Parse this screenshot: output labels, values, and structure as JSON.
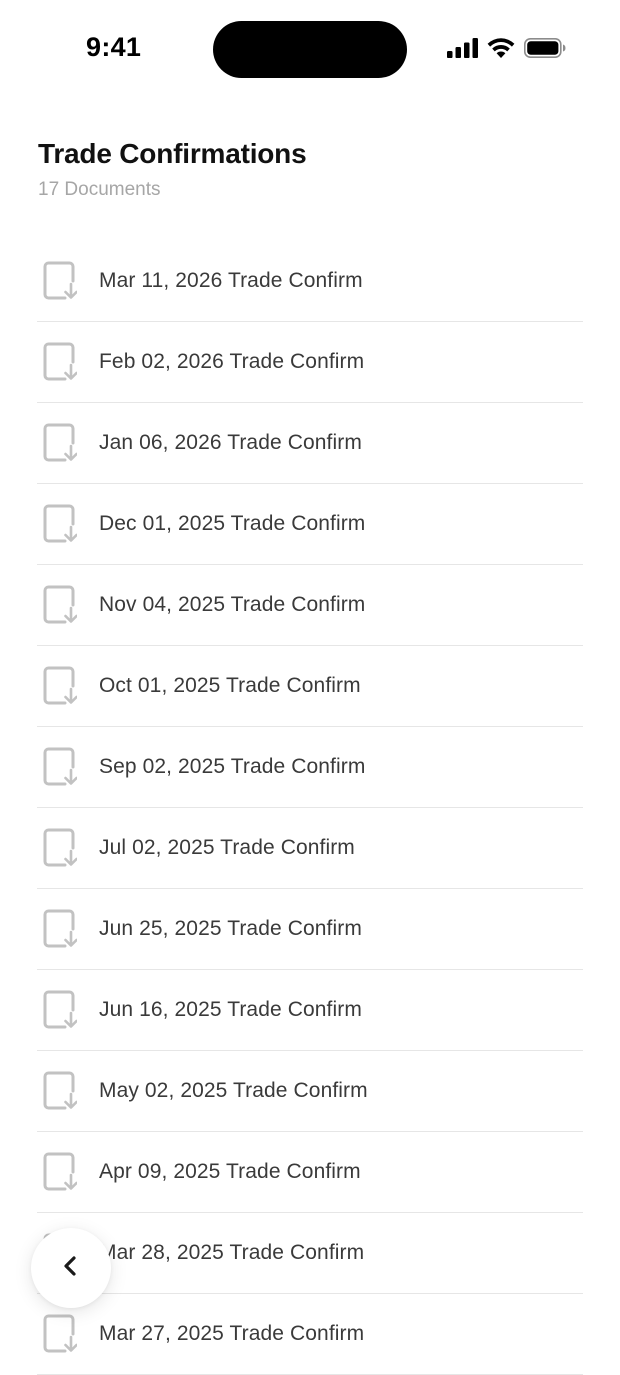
{
  "status_bar": {
    "time": "9:41"
  },
  "header": {
    "title": "Trade Confirmations",
    "count": "17 Documents"
  },
  "documents": [
    {
      "label": "Mar 11, 2026 Trade Confirm",
      "icon": "document-download-icon"
    },
    {
      "label": "Feb 02, 2026 Trade Confirm",
      "icon": "document-download-icon"
    },
    {
      "label": "Jan 06, 2026 Trade Confirm",
      "icon": "document-download-icon"
    },
    {
      "label": "Dec 01, 2025 Trade Confirm",
      "icon": "document-download-icon"
    },
    {
      "label": "Nov 04, 2025 Trade Confirm",
      "icon": "document-download-icon"
    },
    {
      "label": "Oct 01, 2025 Trade Confirm",
      "icon": "document-download-icon"
    },
    {
      "label": "Sep 02, 2025 Trade Confirm",
      "icon": "document-download-icon"
    },
    {
      "label": "Jul 02, 2025 Trade Confirm",
      "icon": "document-download-icon"
    },
    {
      "label": "Jun 25, 2025 Trade Confirm",
      "icon": "document-download-icon"
    },
    {
      "label": "Jun 16, 2025 Trade Confirm",
      "icon": "document-download-icon"
    },
    {
      "label": "May 02, 2025 Trade Confirm",
      "icon": "document-download-icon"
    },
    {
      "label": "Apr 09, 2025 Trade Confirm",
      "icon": "document-download-icon"
    },
    {
      "label": "Mar 28, 2025 Trade Confirm",
      "icon": "document-download-icon"
    },
    {
      "label": "Mar 27, 2025 Trade Confirm",
      "icon": "document-download-icon"
    }
  ],
  "back_button": {
    "icon": "chevron-left-icon"
  },
  "colors": {
    "icon_gray": "#c2c2c2",
    "divider": "#e6e6e6",
    "subtitle": "#a6a6a6"
  }
}
